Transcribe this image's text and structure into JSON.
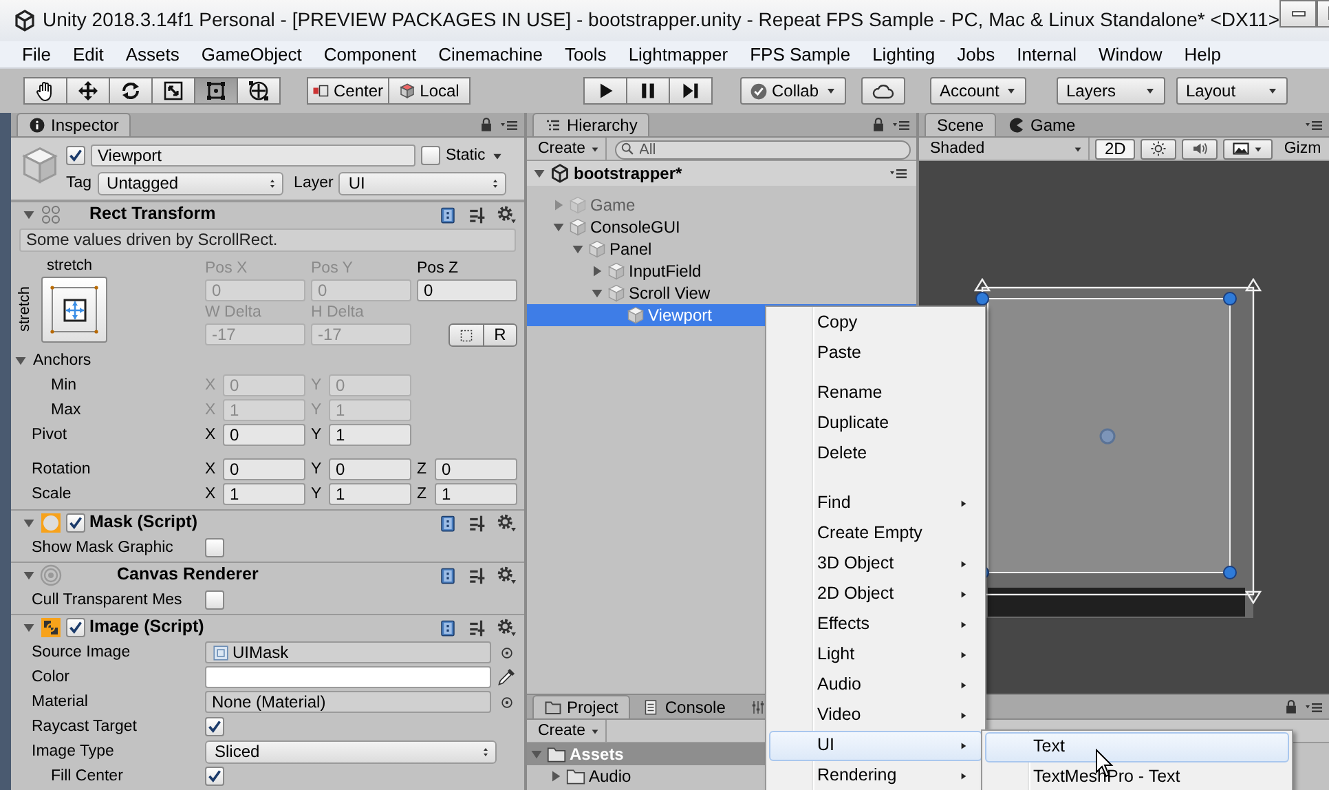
{
  "window": {
    "title": "Unity 2018.3.14f1 Personal - [PREVIEW PACKAGES IN USE] - bootstrapper.unity - Repeat FPS Sample - PC, Mac & Linux Standalone* <DX11>"
  },
  "menu_bar": [
    "File",
    "Edit",
    "Assets",
    "GameObject",
    "Component",
    "Cinemachine",
    "Tools",
    "Lightmapper",
    "FPS Sample",
    "Lighting",
    "Jobs",
    "Internal",
    "Window",
    "Help"
  ],
  "toolbar": {
    "tools": [
      {
        "kind": "hand",
        "selected": false
      },
      {
        "kind": "move",
        "selected": false
      },
      {
        "kind": "rotate",
        "selected": false
      },
      {
        "kind": "scale",
        "selected": false
      },
      {
        "kind": "rect",
        "selected": true
      },
      {
        "kind": "transform",
        "selected": false
      }
    ],
    "pivot_buttons": [
      {
        "kind": "pivot",
        "label": "Center"
      },
      {
        "kind": "local",
        "label": "Local"
      }
    ],
    "play_controls": [
      {
        "kind": "play"
      },
      {
        "kind": "pause"
      },
      {
        "kind": "step"
      }
    ],
    "collab": "Collab",
    "account": "Account",
    "layers": "Layers",
    "layout": "Layout"
  },
  "inspector": {
    "tab": "Inspector",
    "object": {
      "active": true,
      "name": "Viewport",
      "static_label": "Static",
      "static": false,
      "tag_label": "Tag",
      "tag": "Untagged",
      "layer_label": "Layer",
      "layer": "UI"
    },
    "rect_transform": {
      "title": "Rect Transform",
      "expanded": true,
      "note": "Some values driven by ScrollRect.",
      "preset_top": "stretch",
      "preset_side": "stretch",
      "position_fields": [
        {
          "label": "Pos X",
          "value": "0",
          "disabled": true
        },
        {
          "label": "Pos Y",
          "value": "0",
          "disabled": true
        },
        {
          "label": "Pos Z",
          "value": "0",
          "disabled": false
        },
        {
          "label": "W Delta",
          "value": "-17",
          "disabled": true
        },
        {
          "label": "H Delta",
          "value": "-17",
          "disabled": true
        }
      ],
      "raw_button": "R",
      "anchors": {
        "label": "Anchors",
        "expanded": true,
        "rows": [
          {
            "label": "Min",
            "fields": [
              {
                "axis": "X",
                "value": "0",
                "disabled": true
              },
              {
                "axis": "Y",
                "value": "0",
                "disabled": true
              }
            ]
          },
          {
            "label": "Max",
            "fields": [
              {
                "axis": "X",
                "value": "1",
                "disabled": true
              },
              {
                "axis": "Y",
                "value": "1",
                "disabled": true
              }
            ]
          }
        ]
      },
      "rows": [
        {
          "label": "Pivot",
          "fields": [
            {
              "axis": "X",
              "value": "0",
              "disabled": false
            },
            {
              "axis": "Y",
              "value": "1",
              "disabled": false
            }
          ]
        },
        {
          "label": "Rotation",
          "fields": [
            {
              "axis": "X",
              "value": "0",
              "disabled": false
            },
            {
              "axis": "Y",
              "value": "0",
              "disabled": false
            },
            {
              "axis": "Z",
              "value": "0",
              "disabled": false
            }
          ]
        },
        {
          "label": "Scale",
          "fields": [
            {
              "axis": "X",
              "value": "1",
              "disabled": false
            },
            {
              "axis": "Y",
              "value": "1",
              "disabled": false
            },
            {
              "axis": "Z",
              "value": "1",
              "disabled": false
            }
          ]
        }
      ]
    },
    "components": [
      {
        "kind": "mask",
        "title": "Mask (Script)",
        "enabled": true,
        "expanded": true,
        "properties": [
          {
            "kind": "checkbox",
            "label": "Show Mask Graphic",
            "checked": false
          }
        ]
      },
      {
        "kind": "canvas_renderer",
        "title": "Canvas Renderer",
        "expanded": true,
        "properties": [
          {
            "kind": "checkbox",
            "label": "Cull Transparent Mes",
            "checked": false
          }
        ]
      },
      {
        "kind": "image",
        "title": "Image (Script)",
        "enabled": true,
        "expanded": true,
        "properties": [
          {
            "kind": "sprite",
            "label": "Source Image",
            "value": "UIMask"
          },
          {
            "kind": "color",
            "label": "Color",
            "color": "#ffffff"
          },
          {
            "kind": "object",
            "label": "Material",
            "value": "None (Material)"
          },
          {
            "kind": "checkbox",
            "label": "Raycast Target",
            "checked": true
          },
          {
            "kind": "dropdown",
            "label": "Image Type",
            "value": "Sliced",
            "children": [
              {
                "kind": "checkbox",
                "label": "Fill Center",
                "checked": true
              }
            ]
          }
        ]
      }
    ]
  },
  "hierarchy": {
    "tab": "Hierarchy",
    "create": "Create",
    "search_placeholder": "All",
    "scene": {
      "name": "bootstrapper*",
      "expanded": true
    },
    "items": [
      {
        "label": "Game",
        "expanded": false,
        "active": false,
        "selected": false
      },
      {
        "label": "ConsoleGUI",
        "expanded": true,
        "active": true,
        "selected": false,
        "children": [
          {
            "label": "Panel",
            "expanded": true,
            "active": true,
            "selected": false,
            "children": [
              {
                "label": "InputField",
                "expanded": false,
                "active": true,
                "selected": false
              },
              {
                "label": "Scroll View",
                "expanded": true,
                "active": true,
                "selected": false,
                "children": [
                  {
                    "label": "Viewport",
                    "active": true,
                    "selected": true
                  }
                ]
              }
            ]
          }
        ]
      }
    ]
  },
  "scene": {
    "tabs": [
      {
        "kind": "scene",
        "label": "Scene",
        "selected": true
      },
      {
        "kind": "game",
        "label": "Game",
        "selected": false
      }
    ],
    "shading": "Shaded",
    "mode_2d": "2D",
    "gizmos": "Gizm"
  },
  "project": {
    "tabs": [
      {
        "kind": "project",
        "label": "Project",
        "selected": true
      },
      {
        "kind": "console",
        "label": "Console",
        "selected": false
      },
      {
        "kind": "mixer",
        "selected": false
      }
    ],
    "create": "Create",
    "tree": [
      {
        "label": "Assets",
        "expanded": true,
        "selected": true,
        "children": [
          {
            "label": "Audio",
            "expanded": false,
            "selected": false
          }
        ]
      }
    ]
  },
  "context_menu": {
    "items": [
      {
        "kind": "item",
        "label": "Copy",
        "submenu": false,
        "selected": false
      },
      {
        "kind": "item",
        "label": "Paste",
        "submenu": false,
        "selected": false
      },
      {
        "kind": "separator"
      },
      {
        "kind": "item",
        "label": "Rename",
        "submenu": false,
        "selected": false
      },
      {
        "kind": "item",
        "label": "Duplicate",
        "submenu": false,
        "selected": false
      },
      {
        "kind": "item",
        "label": "Delete",
        "submenu": false,
        "selected": false
      },
      {
        "kind": "separator"
      },
      {
        "kind": "separator"
      },
      {
        "kind": "item",
        "label": "Find",
        "submenu": true,
        "selected": false
      },
      {
        "kind": "item",
        "label": "Create Empty",
        "submenu": false,
        "selected": false
      },
      {
        "kind": "item",
        "label": "3D Object",
        "submenu": true,
        "selected": false
      },
      {
        "kind": "item",
        "label": "2D Object",
        "submenu": true,
        "selected": false
      },
      {
        "kind": "item",
        "label": "Effects",
        "submenu": true,
        "selected": false
      },
      {
        "kind": "item",
        "label": "Light",
        "submenu": true,
        "selected": false
      },
      {
        "kind": "item",
        "label": "Audio",
        "submenu": true,
        "selected": false
      },
      {
        "kind": "item",
        "label": "Video",
        "submenu": true,
        "selected": false
      },
      {
        "kind": "item",
        "label": "UI",
        "submenu": true,
        "selected": true
      },
      {
        "kind": "item",
        "label": "Rendering",
        "submenu": true,
        "selected": false
      }
    ]
  },
  "submenu": {
    "items": [
      {
        "kind": "item",
        "label": "Text",
        "submenu": false,
        "selected": true
      },
      {
        "kind": "item",
        "label": "TextMeshPro - Text",
        "submenu": false,
        "selected": false
      }
    ]
  }
}
